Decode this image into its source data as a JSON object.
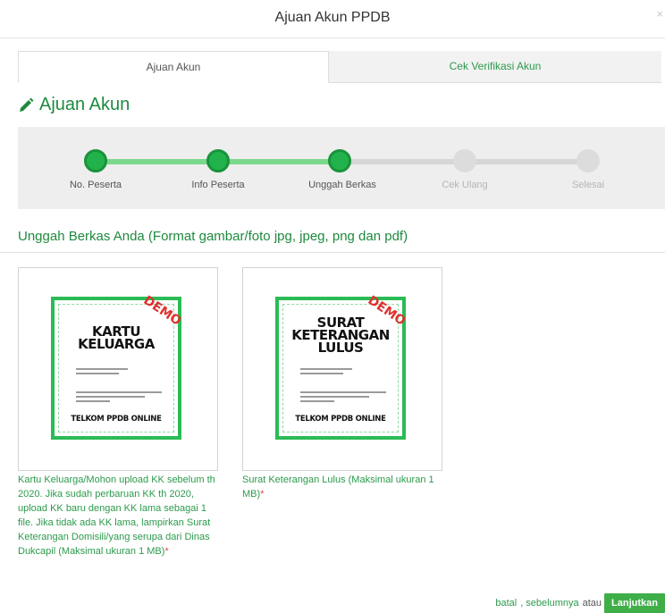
{
  "modal": {
    "title": "Ajuan Akun PPDB",
    "close_label": "×"
  },
  "tabs": [
    {
      "label": "Ajuan Akun"
    },
    {
      "label": "Cek Verifikasi Akun"
    }
  ],
  "section": {
    "title": "Ajuan Akun"
  },
  "steps": [
    {
      "label": "No. Peserta",
      "status": "done"
    },
    {
      "label": "Info Peserta",
      "status": "done"
    },
    {
      "label": "Unggah Berkas",
      "status": "done"
    },
    {
      "label": "Cek Ulang",
      "status": "todo"
    },
    {
      "label": "Selesai",
      "status": "todo"
    }
  ],
  "upload": {
    "heading": "Unggah Berkas Anda (Format gambar/foto jpg, jpeg, png dan pdf)",
    "cards": [
      {
        "doc_title_line1": "KARTU",
        "doc_title_line2": "KELUARGA",
        "doc_title_line3": "",
        "doc_footer": "TELKOM PPDB ONLINE",
        "watermark": "DEMO",
        "caption": "Kartu Keluarga/Mohon upload KK sebelum th 2020. Jika sudah perbaruan KK th 2020, upload KK baru dengan KK lama sebagai 1 file. Jika tidak ada KK lama, lampirkan Surat Keterangan Domisili/yang serupa dari Dinas Dukcapil (Maksimal ukuran 1 MB)",
        "required_mark": "*"
      },
      {
        "doc_title_line1": "SURAT",
        "doc_title_line2": "KETERANGAN",
        "doc_title_line3": "LULUS",
        "doc_footer": "TELKOM PPDB ONLINE",
        "watermark": "DEMO",
        "caption": "Surat Keterangan Lulus (Maksimal ukuran 1 MB)",
        "required_mark": "*"
      }
    ]
  },
  "footer": {
    "cancel": "batal",
    "previous": ", sebelumnya",
    "or": "atau",
    "next": "Lanjutkan"
  },
  "colors": {
    "accent": "#2b9a4b",
    "step_done": "#22b24c",
    "step_todo": "#dcdcdc",
    "button": "#3fae49"
  }
}
